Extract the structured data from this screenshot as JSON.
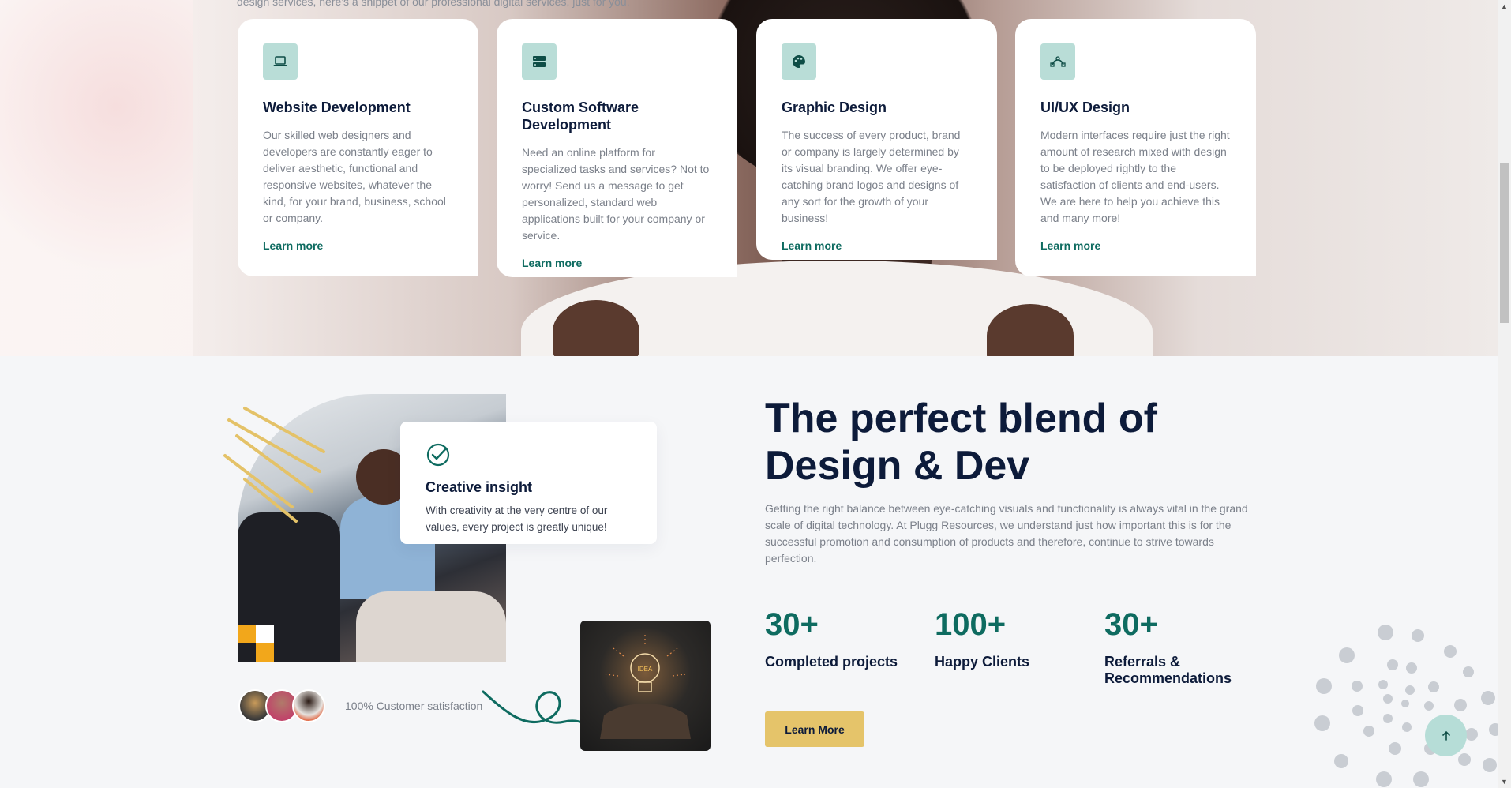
{
  "top_note": "design services, here's a snippet of our professional digital services, just for you.",
  "services": [
    {
      "title": "Website Development",
      "desc": "Our skilled web designers and developers are constantly eager to deliver aesthetic, functional and responsive websites, whatever the kind, for your brand, business, school or company.",
      "link": "Learn more",
      "icon": "laptop-icon"
    },
    {
      "title": "Custom Software Development",
      "desc": "Need an online platform for specialized tasks and services? Not to worry! Send us a message to get personalized, standard web applications built for your company or service.",
      "link": "Learn more",
      "icon": "server-icon"
    },
    {
      "title": "Graphic Design",
      "desc": "The success of every product, brand or company is largely determined by its visual branding. We offer eye-catching brand logos and designs of any sort for the growth of your business!",
      "link": "Learn more",
      "icon": "palette-icon"
    },
    {
      "title": "UI/UX Design",
      "desc": "Modern interfaces require just the right amount of research mixed with design to be deployed rightly to the satisfaction of clients and end-users. We are here to help you achieve this and many more!",
      "link": "Learn more",
      "icon": "bezier-icon"
    }
  ],
  "insight": {
    "title": "Creative insight",
    "desc": "With creativity at the very centre of our values, every project is greatly unique!",
    "icon": "check-circle-icon"
  },
  "satisfaction": "100% Customer satisfaction",
  "blend": {
    "title": "The perfect blend of Design & Dev",
    "desc": "Getting the right balance between eye-catching visuals and functionality is always vital in the grand scale of digital technology. At Plugg Resources, we understand just how important this is for the successful promotion and consumption of products and therefore, continue to strive towards perfection."
  },
  "stats": [
    {
      "num": "30+",
      "label": "Completed projects"
    },
    {
      "num": "100+",
      "label": "Happy Clients"
    },
    {
      "num": "30+",
      "label": "Referrals & Recommendations"
    }
  ],
  "cta": "Learn More",
  "colors": {
    "accent": "#0e6b60",
    "gold": "#e5c46a",
    "navy": "#0d1b3a",
    "icon_bg": "#b9ddd7"
  }
}
